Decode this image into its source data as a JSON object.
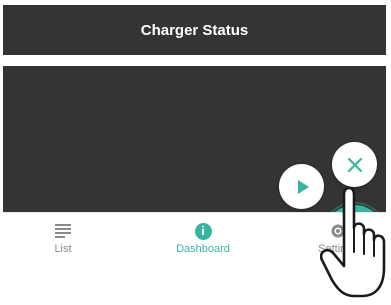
{
  "header": {
    "title": "Charger Status"
  },
  "fab_menu": {
    "play_icon": "play-icon",
    "close_small_icon": "close-icon",
    "settings_icon": "sliders-icon",
    "main_icon": "close-icon"
  },
  "bottom_nav": {
    "items": [
      {
        "label": "List",
        "icon": "list-icon"
      },
      {
        "label": "Dashboard",
        "icon": "info-icon",
        "active": true
      },
      {
        "label": "Settings",
        "icon": "gear-icon"
      }
    ]
  },
  "colors": {
    "accent": "#3ab4a0",
    "bar_background": "#343434",
    "inactive_text": "#8a8a8a"
  }
}
